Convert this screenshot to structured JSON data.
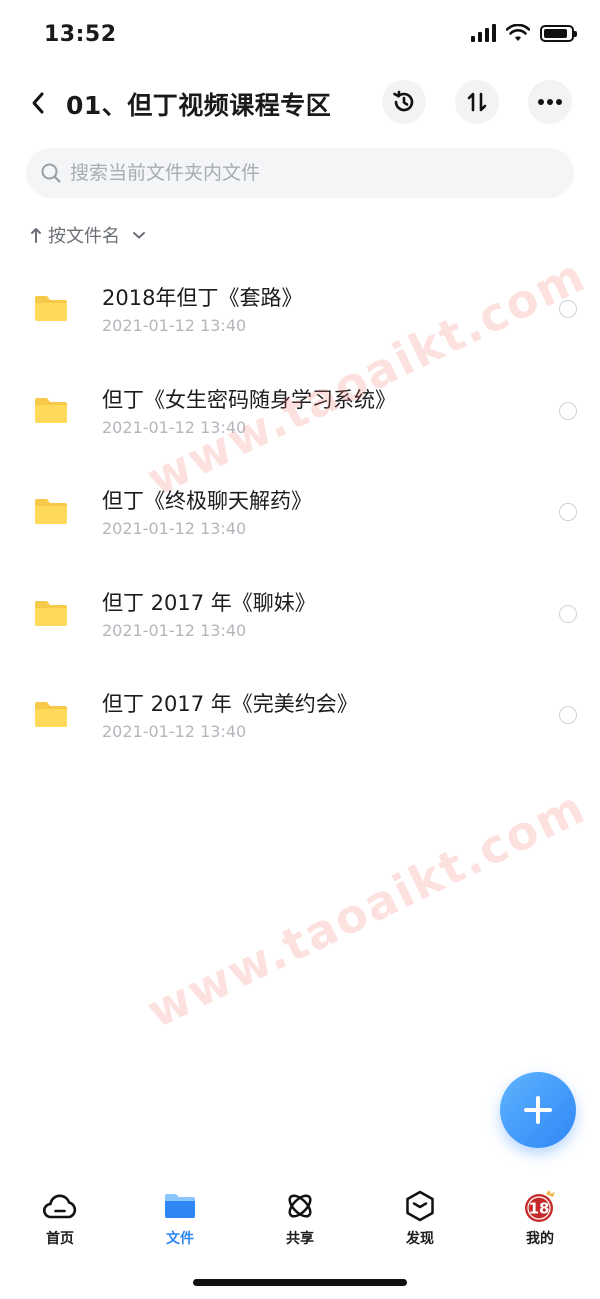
{
  "status_bar": {
    "time": "13:52",
    "battery_level": 0.9
  },
  "header": {
    "title": "01、但丁视频课程专区"
  },
  "search": {
    "placeholder": "搜索当前文件夹内文件"
  },
  "sort": {
    "label": "按文件名"
  },
  "files": [
    {
      "name": "2018年但丁《套路》",
      "date": "2021-01-12 13:40"
    },
    {
      "name": "但丁《女生密码随身学习系统》",
      "date": "2021-01-12 13:40"
    },
    {
      "name": "但丁《终极聊天解药》",
      "date": "2021-01-12 13:40"
    },
    {
      "name": "但丁 2017 年《聊妹》",
      "date": "2021-01-12 13:40"
    },
    {
      "name": "但丁 2017 年《完美约会》",
      "date": "2021-01-12 13:40"
    }
  ],
  "watermark": {
    "text": "www.taoaikt.com"
  },
  "tabs": [
    {
      "label": "首页",
      "icon": "cloud-home-icon"
    },
    {
      "label": "文件",
      "icon": "folder-icon",
      "active": true
    },
    {
      "label": "共享",
      "icon": "atom-share-icon"
    },
    {
      "label": "发现",
      "icon": "discover-box-icon"
    },
    {
      "label": "我的",
      "icon": "avatar-icon"
    }
  ],
  "avatar_badge": "18",
  "colors": {
    "accent": "#2f86f5",
    "folder": "#ffd95a",
    "folder_tab": "#f7c948",
    "watermark": "#f0786e"
  }
}
